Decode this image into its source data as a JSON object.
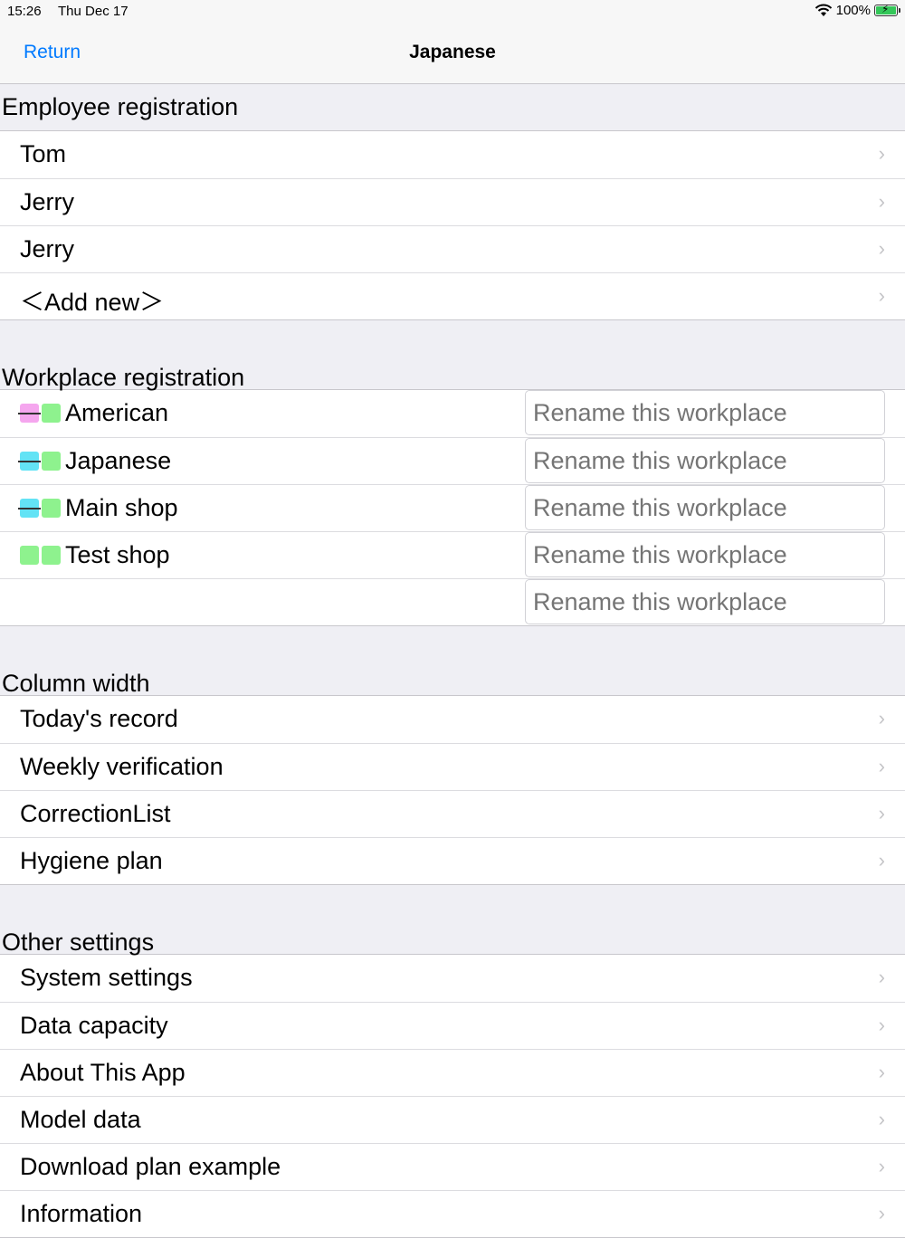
{
  "status": {
    "time": "15:26",
    "date": "Thu Dec 17",
    "battery": "100%"
  },
  "nav": {
    "back_label": "Return",
    "title": "Japanese"
  },
  "employees": {
    "header": "Employee registration",
    "items": [
      "Tom",
      "Jerry",
      "Jerry",
      "＜Add new＞"
    ]
  },
  "workplaces": {
    "header": "Workplace registration",
    "placeholder": "Rename this workplace",
    "items": [
      {
        "name": "American",
        "color1": "#f5a6ee",
        "color2": "#8ef28e",
        "struck": true
      },
      {
        "name": "Japanese",
        "color1": "#63e3f5",
        "color2": "#8ef28e",
        "struck": true
      },
      {
        "name": "Main shop",
        "color1": "#63e3f5",
        "color2": "#8ef28e",
        "struck": true
      },
      {
        "name": "Test shop",
        "color1": "#8ef28e",
        "color2": "#8ef28e",
        "struck": false
      },
      {
        "name": "",
        "color1": "",
        "color2": "",
        "struck": false
      }
    ]
  },
  "columns": {
    "header": "Column width",
    "items": [
      "Today's record",
      "Weekly verification",
      "CorrectionList",
      "Hygiene plan"
    ]
  },
  "other": {
    "header": "Other settings",
    "items": [
      "System settings",
      "Data capacity",
      "About This App",
      "Model data",
      "Download plan example",
      "Information"
    ]
  },
  "icons": {
    "chevron": "chevron-right-icon",
    "wifi": "wifi-icon",
    "battery": "battery-charging-icon"
  },
  "colors": {
    "accent": "#007aff",
    "background": "#efeff4"
  }
}
